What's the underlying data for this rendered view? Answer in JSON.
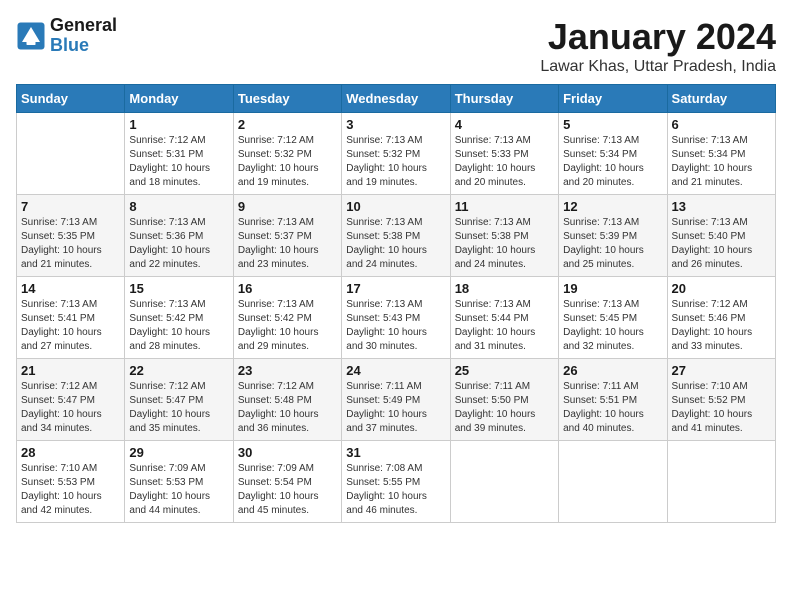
{
  "logo": {
    "text_general": "General",
    "text_blue": "Blue"
  },
  "header": {
    "title": "January 2024",
    "subtitle": "Lawar Khas, Uttar Pradesh, India"
  },
  "days_of_week": [
    "Sunday",
    "Monday",
    "Tuesday",
    "Wednesday",
    "Thursday",
    "Friday",
    "Saturday"
  ],
  "weeks": [
    [
      {
        "day": "",
        "info": ""
      },
      {
        "day": "1",
        "info": "Sunrise: 7:12 AM\nSunset: 5:31 PM\nDaylight: 10 hours\nand 18 minutes."
      },
      {
        "day": "2",
        "info": "Sunrise: 7:12 AM\nSunset: 5:32 PM\nDaylight: 10 hours\nand 19 minutes."
      },
      {
        "day": "3",
        "info": "Sunrise: 7:13 AM\nSunset: 5:32 PM\nDaylight: 10 hours\nand 19 minutes."
      },
      {
        "day": "4",
        "info": "Sunrise: 7:13 AM\nSunset: 5:33 PM\nDaylight: 10 hours\nand 20 minutes."
      },
      {
        "day": "5",
        "info": "Sunrise: 7:13 AM\nSunset: 5:34 PM\nDaylight: 10 hours\nand 20 minutes."
      },
      {
        "day": "6",
        "info": "Sunrise: 7:13 AM\nSunset: 5:34 PM\nDaylight: 10 hours\nand 21 minutes."
      }
    ],
    [
      {
        "day": "7",
        "info": "Sunrise: 7:13 AM\nSunset: 5:35 PM\nDaylight: 10 hours\nand 21 minutes."
      },
      {
        "day": "8",
        "info": "Sunrise: 7:13 AM\nSunset: 5:36 PM\nDaylight: 10 hours\nand 22 minutes."
      },
      {
        "day": "9",
        "info": "Sunrise: 7:13 AM\nSunset: 5:37 PM\nDaylight: 10 hours\nand 23 minutes."
      },
      {
        "day": "10",
        "info": "Sunrise: 7:13 AM\nSunset: 5:38 PM\nDaylight: 10 hours\nand 24 minutes."
      },
      {
        "day": "11",
        "info": "Sunrise: 7:13 AM\nSunset: 5:38 PM\nDaylight: 10 hours\nand 24 minutes."
      },
      {
        "day": "12",
        "info": "Sunrise: 7:13 AM\nSunset: 5:39 PM\nDaylight: 10 hours\nand 25 minutes."
      },
      {
        "day": "13",
        "info": "Sunrise: 7:13 AM\nSunset: 5:40 PM\nDaylight: 10 hours\nand 26 minutes."
      }
    ],
    [
      {
        "day": "14",
        "info": "Sunrise: 7:13 AM\nSunset: 5:41 PM\nDaylight: 10 hours\nand 27 minutes."
      },
      {
        "day": "15",
        "info": "Sunrise: 7:13 AM\nSunset: 5:42 PM\nDaylight: 10 hours\nand 28 minutes."
      },
      {
        "day": "16",
        "info": "Sunrise: 7:13 AM\nSunset: 5:42 PM\nDaylight: 10 hours\nand 29 minutes."
      },
      {
        "day": "17",
        "info": "Sunrise: 7:13 AM\nSunset: 5:43 PM\nDaylight: 10 hours\nand 30 minutes."
      },
      {
        "day": "18",
        "info": "Sunrise: 7:13 AM\nSunset: 5:44 PM\nDaylight: 10 hours\nand 31 minutes."
      },
      {
        "day": "19",
        "info": "Sunrise: 7:13 AM\nSunset: 5:45 PM\nDaylight: 10 hours\nand 32 minutes."
      },
      {
        "day": "20",
        "info": "Sunrise: 7:12 AM\nSunset: 5:46 PM\nDaylight: 10 hours\nand 33 minutes."
      }
    ],
    [
      {
        "day": "21",
        "info": "Sunrise: 7:12 AM\nSunset: 5:47 PM\nDaylight: 10 hours\nand 34 minutes."
      },
      {
        "day": "22",
        "info": "Sunrise: 7:12 AM\nSunset: 5:47 PM\nDaylight: 10 hours\nand 35 minutes."
      },
      {
        "day": "23",
        "info": "Sunrise: 7:12 AM\nSunset: 5:48 PM\nDaylight: 10 hours\nand 36 minutes."
      },
      {
        "day": "24",
        "info": "Sunrise: 7:11 AM\nSunset: 5:49 PM\nDaylight: 10 hours\nand 37 minutes."
      },
      {
        "day": "25",
        "info": "Sunrise: 7:11 AM\nSunset: 5:50 PM\nDaylight: 10 hours\nand 39 minutes."
      },
      {
        "day": "26",
        "info": "Sunrise: 7:11 AM\nSunset: 5:51 PM\nDaylight: 10 hours\nand 40 minutes."
      },
      {
        "day": "27",
        "info": "Sunrise: 7:10 AM\nSunset: 5:52 PM\nDaylight: 10 hours\nand 41 minutes."
      }
    ],
    [
      {
        "day": "28",
        "info": "Sunrise: 7:10 AM\nSunset: 5:53 PM\nDaylight: 10 hours\nand 42 minutes."
      },
      {
        "day": "29",
        "info": "Sunrise: 7:09 AM\nSunset: 5:53 PM\nDaylight: 10 hours\nand 44 minutes."
      },
      {
        "day": "30",
        "info": "Sunrise: 7:09 AM\nSunset: 5:54 PM\nDaylight: 10 hours\nand 45 minutes."
      },
      {
        "day": "31",
        "info": "Sunrise: 7:08 AM\nSunset: 5:55 PM\nDaylight: 10 hours\nand 46 minutes."
      },
      {
        "day": "",
        "info": ""
      },
      {
        "day": "",
        "info": ""
      },
      {
        "day": "",
        "info": ""
      }
    ]
  ]
}
